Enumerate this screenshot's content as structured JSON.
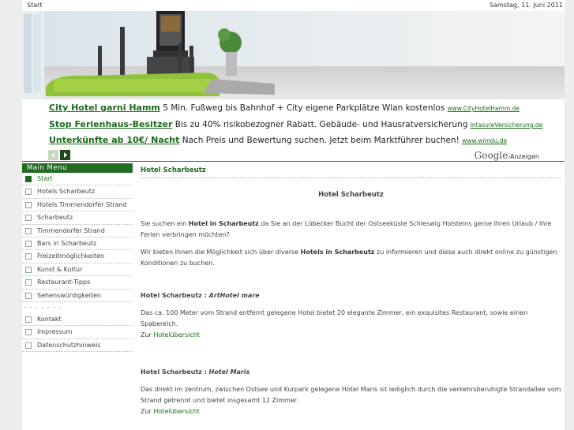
{
  "topbar": {
    "start": "Start",
    "date": "Samstag, 11. Juni 2011"
  },
  "ads": [
    {
      "title": "City Hotel garni Hamm",
      "text": " 5 Min. Fußweg bis Bahnhof + City eigene Parkplätze Wlan kostenlos ",
      "url": "www.CityHotelHamm.de"
    },
    {
      "title": "Stop Ferienhaus-Besitzer",
      "text": " Bis zu 40% risikobezogner Rabatt. Gebäude- und Hausratversicherung ",
      "url": "IntasureVersicherung.de"
    },
    {
      "title": "Unterkünfte ab 10€/ Nacht",
      "text": " Nach Preis und Bewertung suchen. Jetzt beim Marktführer buchen! ",
      "url": "www.wimdu.de"
    }
  ],
  "google": {
    "logo": "Google",
    "label": "-Anzeigen"
  },
  "menu": {
    "header": "Main Menu",
    "items": [
      "Start",
      "Hotels Scharbeutz",
      "Hotels Timmendorfer Strand",
      "Scharbeutz",
      "Timmendorfer Strand",
      "Bars in Scharbeutz",
      "Freizeitmöglichkeiten",
      "Kunst & Kultur",
      "Restaurant-Tipps",
      "Sehenswürdigkeiten"
    ],
    "separator": "- - - - - - -",
    "items2": [
      "Kontakt",
      "Impressum",
      "Datenschutzhinweis"
    ]
  },
  "content": {
    "heading": "Hotel Scharbeutz",
    "center_title": "Hotel Scharbeutz",
    "p1a": "Sie suchen ein ",
    "p1b": "Hotel in Scharbeutz",
    "p1c": " da Sie an der Lübecker Bucht der Ostseeküste Schleswig Holsteins gerne Ihren Urlaub / Ihre Ferien verbringen möchten?",
    "p2a": "Wir bieten Ihnen die Möglichkeit sich über diverse ",
    "p2b": "Hotels in Scharbeutz",
    "p2c": " zu informieren und diese auch direkt online zu günstigen Konditionen zu buchen.",
    "h1_prefix": "Hotel Scharbeutz : ",
    "h1_name": "ArtHotel mare",
    "d1": "Das ca. 100 Meter vom Strand entfernt gelegene Hotel bietet 20 elegante Zimmer, ein exquisites Restaurant, sowie einen Spabereich.",
    "link_prefix": "Zur ",
    "link_text": "Hotelübersicht",
    "h2_prefix": "Hotel Scharbeutz : ",
    "h2_name": "Hotel Maris",
    "d2": "Das direkt im zentrum, zwischen Ostsee und Kurpark gelegene Hotel Maris ist lediglich durch die verkehrsberuhigte Strandallee vom Strand getrennt und bietet insgesamt 12 Zimmer."
  }
}
